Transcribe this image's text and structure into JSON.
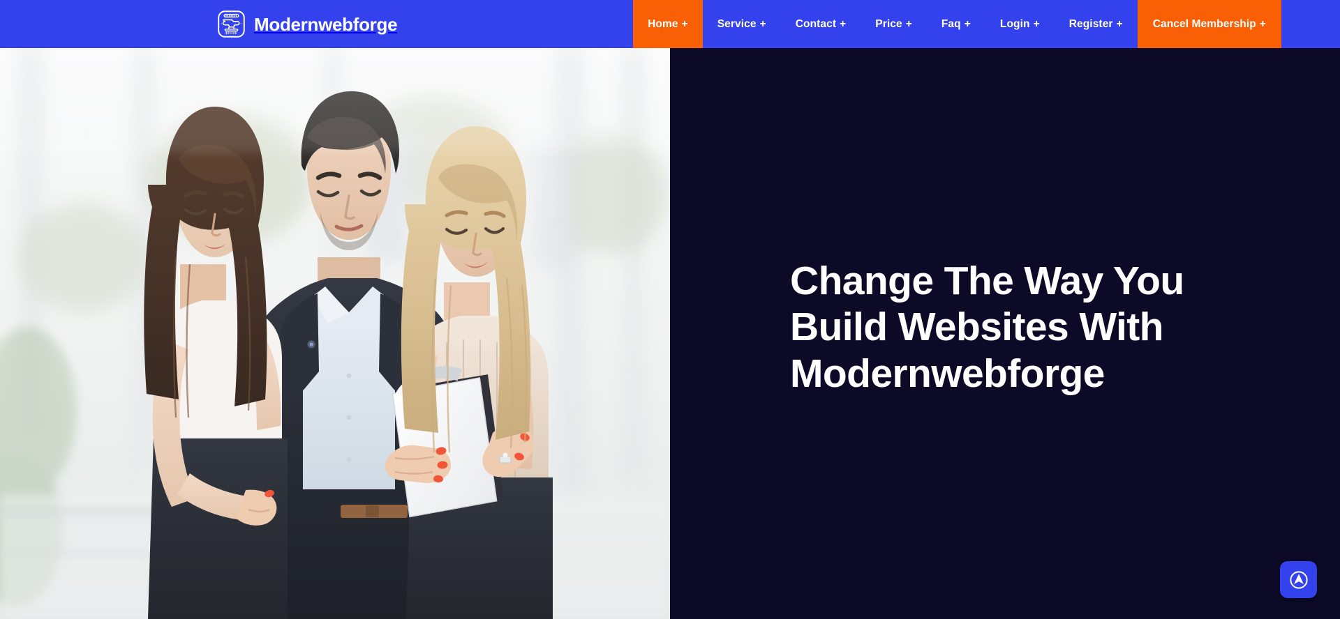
{
  "theme": {
    "brand_blue": "#3442ED",
    "accent_orange": "#F95F04",
    "panel_dark": "#0D0A28",
    "text_light": "#FFFFFF"
  },
  "header": {
    "logo_icon": "anvil-forge-icon",
    "brand_name": "Modernwebforge",
    "nav_items": [
      {
        "label": "Home",
        "suffix": "+",
        "state": "active"
      },
      {
        "label": "Service",
        "suffix": "+",
        "state": "default"
      },
      {
        "label": "Contact",
        "suffix": "+",
        "state": "default"
      },
      {
        "label": "Price",
        "suffix": "+",
        "state": "default"
      },
      {
        "label": "Faq",
        "suffix": "+",
        "state": "default"
      },
      {
        "label": "Login",
        "suffix": "+",
        "state": "default"
      },
      {
        "label": "Register",
        "suffix": "+",
        "state": "default"
      },
      {
        "label": "Cancel Membership",
        "suffix": "+",
        "state": "cta"
      }
    ]
  },
  "hero": {
    "image_alt": "Three business colleagues reviewing a document together in a bright office",
    "title": "Change The Way You Build Websites With Modernwebforge"
  },
  "floating_button": {
    "icon": "navigation-arrow-circle-icon",
    "label": "Scroll to top"
  }
}
